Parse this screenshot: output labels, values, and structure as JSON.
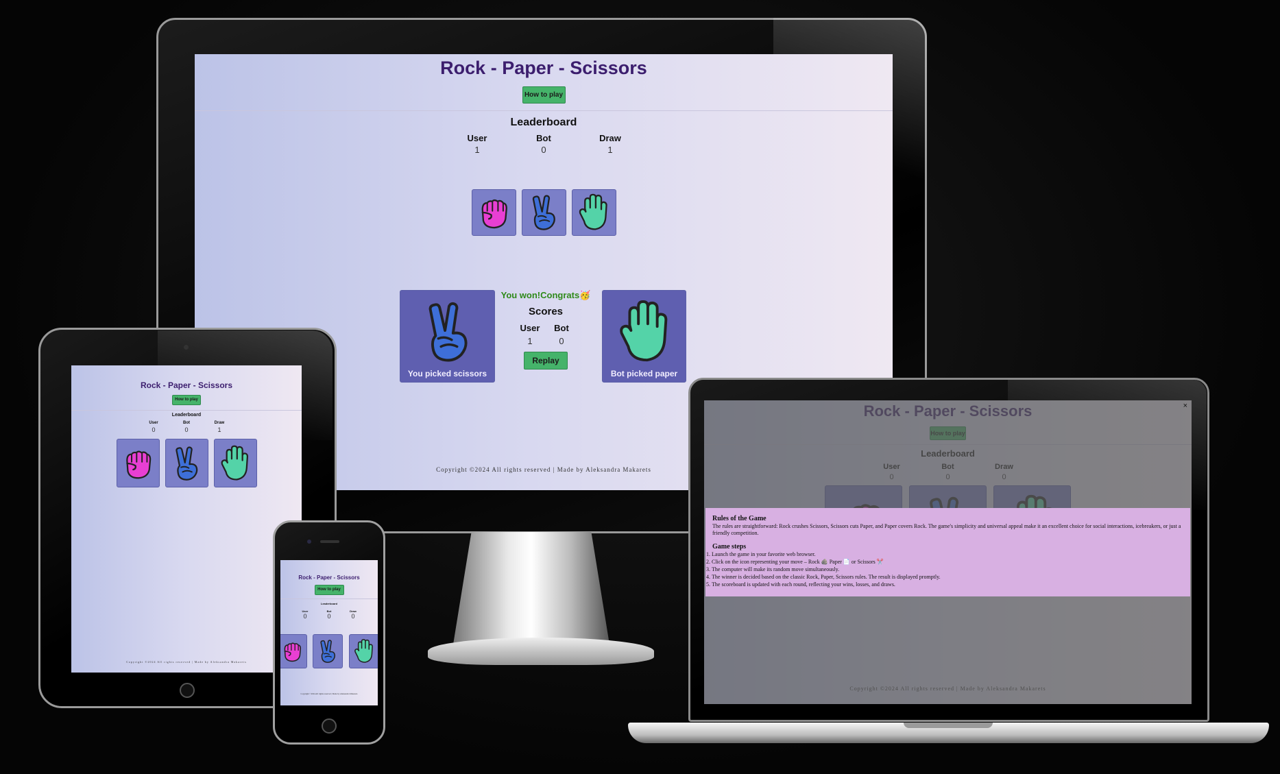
{
  "game": {
    "title": "Rock - Paper - Scissors",
    "how_to_play": "How to play",
    "leaderboard_title": "Leaderboard",
    "col_user": "User",
    "col_bot": "Bot",
    "col_draw": "Draw",
    "footer": "Copyright ©2024 All rights reserved | Made by Aleksandra Makarets"
  },
  "desktop": {
    "leaderboard": {
      "user": "1",
      "bot": "0",
      "draw": "1"
    },
    "result_message": "You won!Congrats",
    "scores_title": "Scores",
    "scores": {
      "user": "1",
      "bot": "0"
    },
    "user_pick_label": "You picked scissors",
    "bot_pick_label": "Bot picked paper",
    "replay": "Replay"
  },
  "tablet": {
    "leaderboard": {
      "user": "0",
      "bot": "0",
      "draw": "1"
    }
  },
  "phone": {
    "leaderboard": {
      "user": "0",
      "bot": "0",
      "draw": "0"
    }
  },
  "laptop": {
    "leaderboard": {
      "user": "0",
      "bot": "0",
      "draw": "0"
    },
    "modal_close": "×",
    "rules_title": "Rules of the Game",
    "rules_text": "The rules are straightforward: Rock crushes Scissors, Scissors cuts Paper, and Paper covers Rock. The game's simplicity and universal appeal make it an excellent choice for social interactions, icebreakers, or just a friendly competition.",
    "steps_title": "Game steps",
    "steps": [
      "Launch the game in your favorite web browser.",
      "Click on the icon representing your move – Rock 🪨 Paper 📄 or Scissors ✂️",
      "The computer will make its random move simultaneously.",
      "The winner is decided based on the classic Rock, Paper, Scissors rules. The result is displayed promptly.",
      "The scoreboard is updated with each round, reflecting your wins, losses, and draws."
    ]
  },
  "colors": {
    "rock": "#e83fd3",
    "scissors": "#3e6fd8",
    "paper": "#54d3a8",
    "button": "#45b36a",
    "title": "#3c1e6e"
  }
}
